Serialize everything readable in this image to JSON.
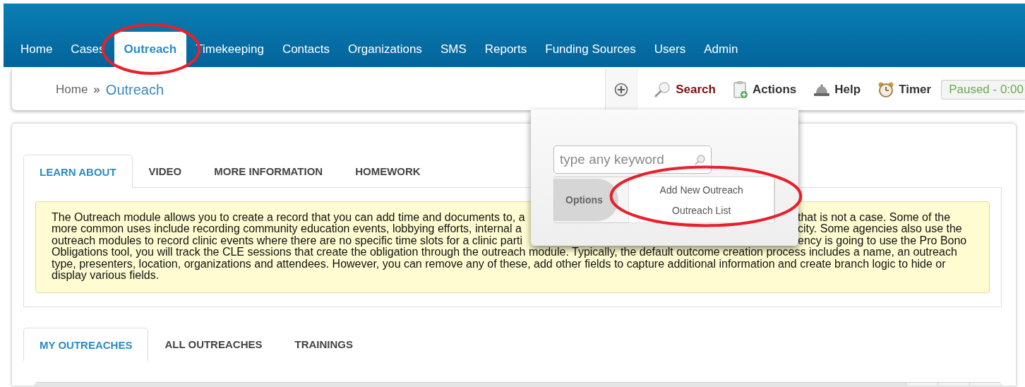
{
  "nav": [
    {
      "label": "Home",
      "selected": false
    },
    {
      "label": "Cases",
      "selected": false
    },
    {
      "label": "Outreach",
      "selected": true
    },
    {
      "label": "Timekeeping",
      "selected": false
    },
    {
      "label": "Contacts",
      "selected": false
    },
    {
      "label": "Organizations",
      "selected": false
    },
    {
      "label": "SMS",
      "selected": false
    },
    {
      "label": "Reports",
      "selected": false
    },
    {
      "label": "Funding Sources",
      "selected": false
    },
    {
      "label": "Users",
      "selected": false
    },
    {
      "label": "Admin",
      "selected": false
    }
  ],
  "breadcrumb": {
    "home": "Home",
    "separator": "»",
    "current": "Outreach"
  },
  "toolbar": {
    "items": [
      {
        "kind": "add"
      },
      {
        "kind": "search",
        "label": "Search",
        "active": true
      },
      {
        "kind": "actions",
        "label": "Actions",
        "active": false
      },
      {
        "kind": "help",
        "label": "Help",
        "active": false
      },
      {
        "kind": "timer",
        "label": "Timer",
        "active": false
      }
    ],
    "timer_status": "Paused - 0:00"
  },
  "search_popup": {
    "placeholder": "type any keyword",
    "options_label": "Options",
    "menu": [
      "Add New Outreach",
      "Outreach List"
    ]
  },
  "info_tabs": [
    {
      "label": "LEARN ABOUT",
      "selected": true
    },
    {
      "label": "VIDEO",
      "selected": false
    },
    {
      "label": "MORE INFORMATION",
      "selected": false
    },
    {
      "label": "HOMEWORK",
      "selected": false
    }
  ],
  "description_lines": [
    {
      "left": "The Outreach module allows you to create a record that you can add time and documents to, a",
      "right": "that is not a case. Some of the"
    },
    {
      "left": "more common uses include recording community education events, lobbying efforts, internal a",
      "right": "city. Some agencies also use the"
    },
    {
      "left": "outreach modules to record clinic events where there are no specific time slots for a clinic parti",
      "right": "ency is going to use the Pro Bono"
    },
    {
      "left": "Obligations tool, you will track the CLE sessions that create the obligation through the outreach module. Typically, the default outcome creation process includes a name, an outreach"
    },
    {
      "left": "type, presenters, location, organizations and attendees. However, you can remove any of these, add other fields to capture additional information and create branch logic to hide or"
    },
    {
      "left": "display various fields."
    }
  ],
  "list_tabs": [
    {
      "label": "MY OUTREACHES",
      "selected": true
    },
    {
      "label": "ALL OUTREACHES",
      "selected": false
    },
    {
      "label": "TRAININGS",
      "selected": false
    }
  ],
  "annotations": [
    {
      "kind": "ellipse",
      "color": "#e8202a"
    },
    {
      "kind": "ellipse",
      "color": "#e8202a"
    }
  ]
}
